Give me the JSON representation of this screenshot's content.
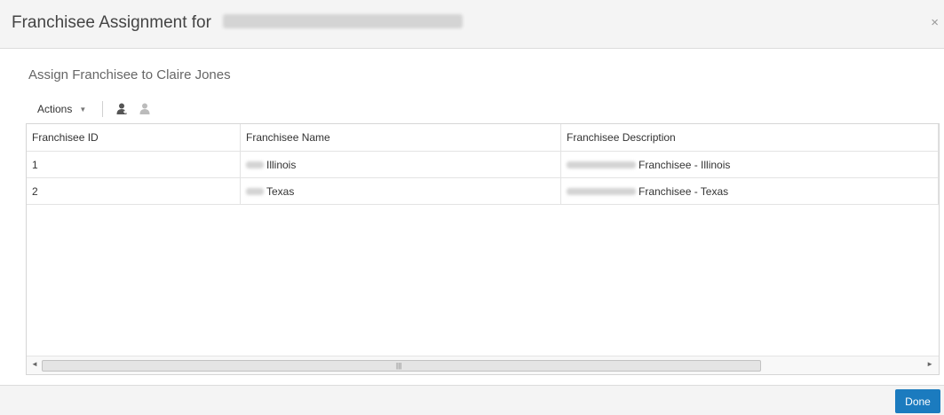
{
  "dialog": {
    "title": "Franchisee Assignment for",
    "close_label": "×"
  },
  "subtitle": "Assign Franchisee to Claire Jones",
  "toolbar": {
    "actions_label": "Actions",
    "actions_caret": "▼",
    "icons": [
      "assign-user-icon",
      "unassign-user-icon"
    ]
  },
  "table": {
    "columns": [
      "Franchisee ID",
      "Franchisee Name",
      "Franchisee Description"
    ],
    "rows": [
      {
        "id": "1",
        "name": "Illinois",
        "description": "Franchisee - Illinois"
      },
      {
        "id": "2",
        "name": "Texas",
        "description": "Franchisee - Texas"
      }
    ]
  },
  "scrollbar": {
    "left_arrow": "◄",
    "right_arrow": "►",
    "grip": "|||"
  },
  "footer": {
    "done_label": "Done"
  },
  "colors": {
    "primary_button": "#1b7bbf",
    "header_bg": "#f4f4f4"
  }
}
